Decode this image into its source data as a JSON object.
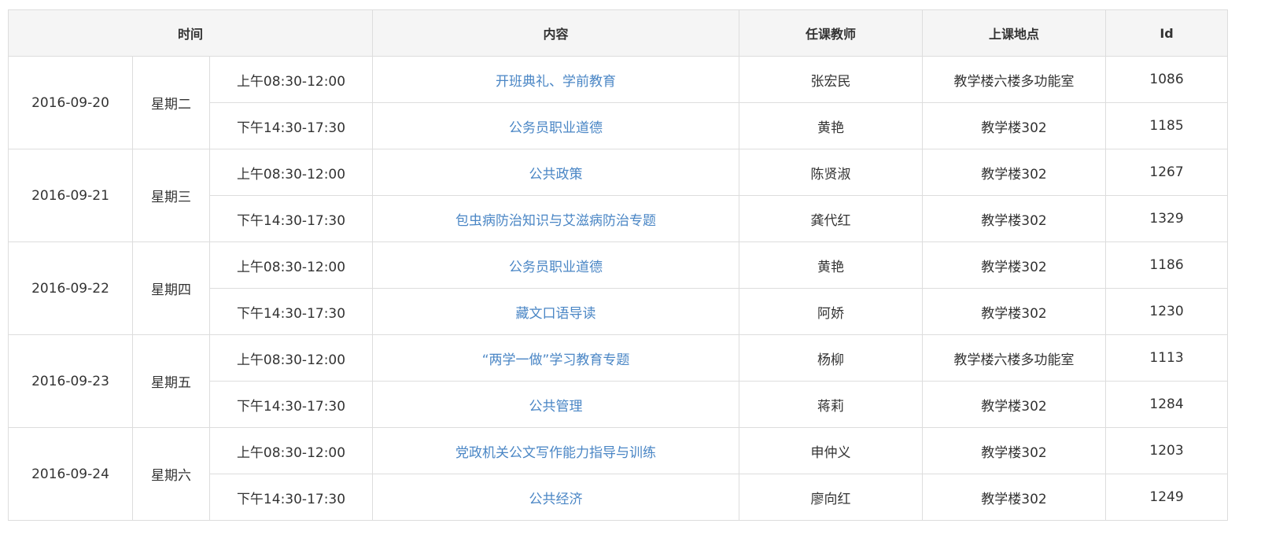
{
  "headers": {
    "time": "时间",
    "content": "内容",
    "teacher": "任课教师",
    "location": "上课地点",
    "id": "Id"
  },
  "days": [
    {
      "date": "2016-09-20",
      "weekday": "星期二",
      "sessions": [
        {
          "time": "上午08:30-12:00",
          "content": "开班典礼、学前教育",
          "teacher": "张宏民",
          "location": "教学楼六楼多功能室",
          "id": "1086"
        },
        {
          "time": "下午14:30-17:30",
          "content": "公务员职业道德",
          "teacher": "黄艳",
          "location": "教学楼302",
          "id": "1185"
        }
      ]
    },
    {
      "date": "2016-09-21",
      "weekday": "星期三",
      "sessions": [
        {
          "time": "上午08:30-12:00",
          "content": "公共政策",
          "teacher": "陈贤淑",
          "location": "教学楼302",
          "id": "1267"
        },
        {
          "time": "下午14:30-17:30",
          "content": "包虫病防治知识与艾滋病防治专题",
          "teacher": "龚代红",
          "location": "教学楼302",
          "id": "1329"
        }
      ]
    },
    {
      "date": "2016-09-22",
      "weekday": "星期四",
      "sessions": [
        {
          "time": "上午08:30-12:00",
          "content": "公务员职业道德",
          "teacher": "黄艳",
          "location": "教学楼302",
          "id": "1186"
        },
        {
          "time": "下午14:30-17:30",
          "content": "藏文口语导读",
          "teacher": "阿娇",
          "location": "教学楼302",
          "id": "1230"
        }
      ]
    },
    {
      "date": "2016-09-23",
      "weekday": "星期五",
      "sessions": [
        {
          "time": "上午08:30-12:00",
          "content": "“两学一做”学习教育专题",
          "teacher": "杨柳",
          "location": "教学楼六楼多功能室",
          "id": "1113"
        },
        {
          "time": "下午14:30-17:30",
          "content": "公共管理",
          "teacher": "蒋莉",
          "location": "教学楼302",
          "id": "1284"
        }
      ]
    },
    {
      "date": "2016-09-24",
      "weekday": "星期六",
      "sessions": [
        {
          "time": "上午08:30-12:00",
          "content": "党政机关公文写作能力指导与训练",
          "teacher": "申仲义",
          "location": "教学楼302",
          "id": "1203"
        },
        {
          "time": "下午14:30-17:30",
          "content": "公共经济",
          "teacher": "廖向红",
          "location": "教学楼302",
          "id": "1249"
        }
      ]
    }
  ],
  "colors": {
    "link": "#4a86c5",
    "header_bg": "#f5f5f5",
    "border": "#dddddd",
    "text": "#333333"
  }
}
